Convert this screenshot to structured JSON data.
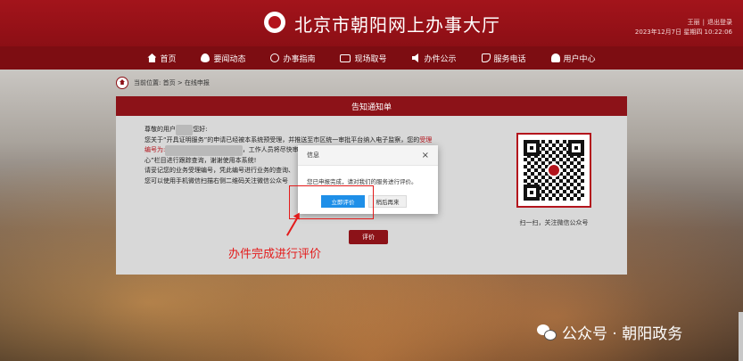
{
  "header": {
    "site_title": "北京市朝阳网上办事大厅",
    "user_name": "王丽",
    "logout": "退出登录",
    "datetime": "2023年12月7日 星期四 10:22:06"
  },
  "nav": {
    "items": [
      {
        "label": "首页",
        "icon": "home-icon"
      },
      {
        "label": "要闻动态",
        "icon": "flame-icon"
      },
      {
        "label": "办事指南",
        "icon": "compass-icon"
      },
      {
        "label": "现场取号",
        "icon": "ticket-icon"
      },
      {
        "label": "办件公示",
        "icon": "speaker-icon"
      },
      {
        "label": "服务电话",
        "icon": "phone-icon"
      },
      {
        "label": "用户中心",
        "icon": "user-icon"
      }
    ]
  },
  "breadcrumb": {
    "prefix": "当前位置:",
    "path": "首页 > 在线申报"
  },
  "notice": {
    "title": "告知通知单",
    "greeting_prefix": "尊敬的用户",
    "greeting_suffix": "您好:",
    "line1_a": "您关于“开具证明服务”的申请已经被本系统预受理，并推送至市区统一审批平台纳入电子监察，您的",
    "line1_red": "受理",
    "line2_red": "编号为:",
    "line2_b": "，工作人员将尽快审核您申请",
    "line3": "心”栏目进行跟踪查询，谢谢使用本系统!",
    "line4": "请妥记您的业务受理编号，凭此编号进行业务的查询、",
    "line5": "您可以使用手机微信扫描右侧二维码关注微信公众号",
    "qr_caption": "扫一扫，关注微信公众号",
    "eval_button": "评价"
  },
  "dialog": {
    "title": "信息",
    "close": "×",
    "message": "您已申报完成，请对我们的服务进行评价。",
    "primary_button": "立即评价",
    "secondary_button": "稍后再来"
  },
  "annotation": {
    "text": "办件完成进行评价"
  },
  "watermark": {
    "text": "公众号 · 朝阳政务"
  },
  "colors": {
    "brand_red": "#8c0f15",
    "primary_blue": "#1e8fe8",
    "annotation_red": "#e31b1b"
  }
}
